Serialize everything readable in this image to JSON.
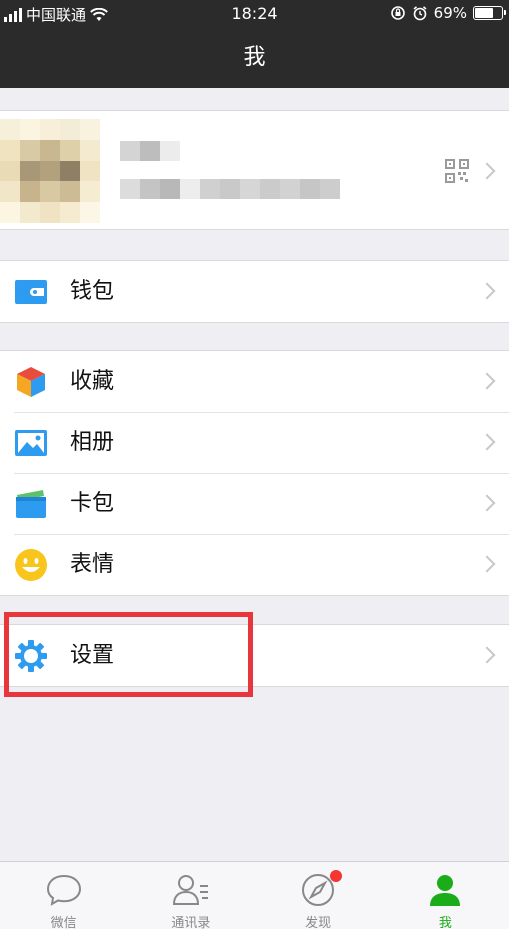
{
  "status_bar": {
    "carrier": "中国联通",
    "time": "18:24",
    "battery_percent": "69%",
    "battery_level": 0.69
  },
  "nav": {
    "title": "我"
  },
  "profile": {
    "qr_icon": "qr-code-icon"
  },
  "groups": [
    {
      "items": [
        {
          "label": "钱包",
          "icon": "wallet-icon",
          "color": "#2d9bf0"
        }
      ]
    },
    {
      "items": [
        {
          "label": "收藏",
          "icon": "favorites-cube-icon",
          "color": "#f5a623"
        },
        {
          "label": "相册",
          "icon": "photo-album-icon",
          "color": "#2d9bf0"
        },
        {
          "label": "卡包",
          "icon": "card-wallet-icon",
          "color": "#2d9bf0"
        },
        {
          "label": "表情",
          "icon": "smiley-icon",
          "color": "#f7c51c"
        }
      ]
    },
    {
      "items": [
        {
          "label": "设置",
          "icon": "gear-icon",
          "color": "#2d9bf0"
        }
      ]
    }
  ],
  "tab_bar": {
    "tabs": [
      {
        "label": "微信",
        "icon": "chat-bubble-icon",
        "active": false
      },
      {
        "label": "通讯录",
        "icon": "contacts-icon",
        "active": false
      },
      {
        "label": "发现",
        "icon": "compass-icon",
        "active": false,
        "badge": true
      },
      {
        "label": "我",
        "icon": "person-icon",
        "active": true
      }
    ]
  },
  "colors": {
    "header_bg": "#2b2b2b",
    "page_bg": "#eeeef3",
    "active_tab": "#1aad19",
    "highlight_border": "#e8363d",
    "badge": "#f43530"
  }
}
